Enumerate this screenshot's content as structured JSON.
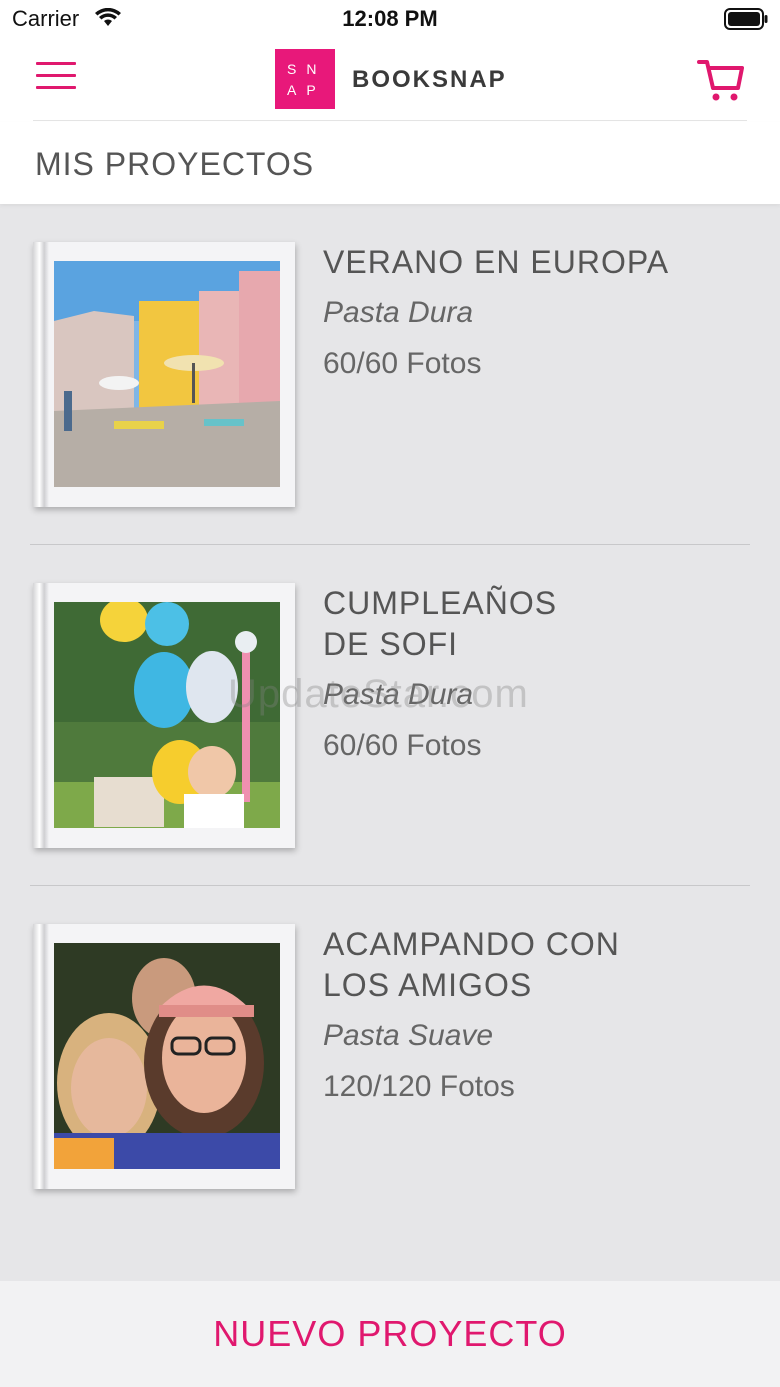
{
  "status_bar": {
    "carrier": "Carrier",
    "time": "12:08 PM"
  },
  "navbar": {
    "logo_line1": "SN",
    "logo_line2": "AP",
    "brand": "BOOKSNAP",
    "accent_color": "#e0186e",
    "icons": [
      "hamburger-menu-icon",
      "cart-icon"
    ]
  },
  "section": {
    "title": "MIS PROYECTOS"
  },
  "projects": [
    {
      "title": "VERANO EN EUROPA",
      "cover": "Pasta Dura",
      "photos": "60/60 Fotos",
      "image": "town square with colorful buildings and umbrellas"
    },
    {
      "title": "CUMPLEAÑOS\nDE SOFI",
      "cover": "Pasta Dura",
      "photos": "60/60 Fotos",
      "image": "baby with balloons in a park"
    },
    {
      "title": "ACAMPANDO CON\nLOS AMIGOS",
      "cover": "Pasta Suave",
      "photos": "120/120 Fotos",
      "image": "friends taking a selfie"
    }
  ],
  "watermark": "UpdateStar.com",
  "bottom": {
    "new_project_label": "NUEVO PROYECTO"
  }
}
